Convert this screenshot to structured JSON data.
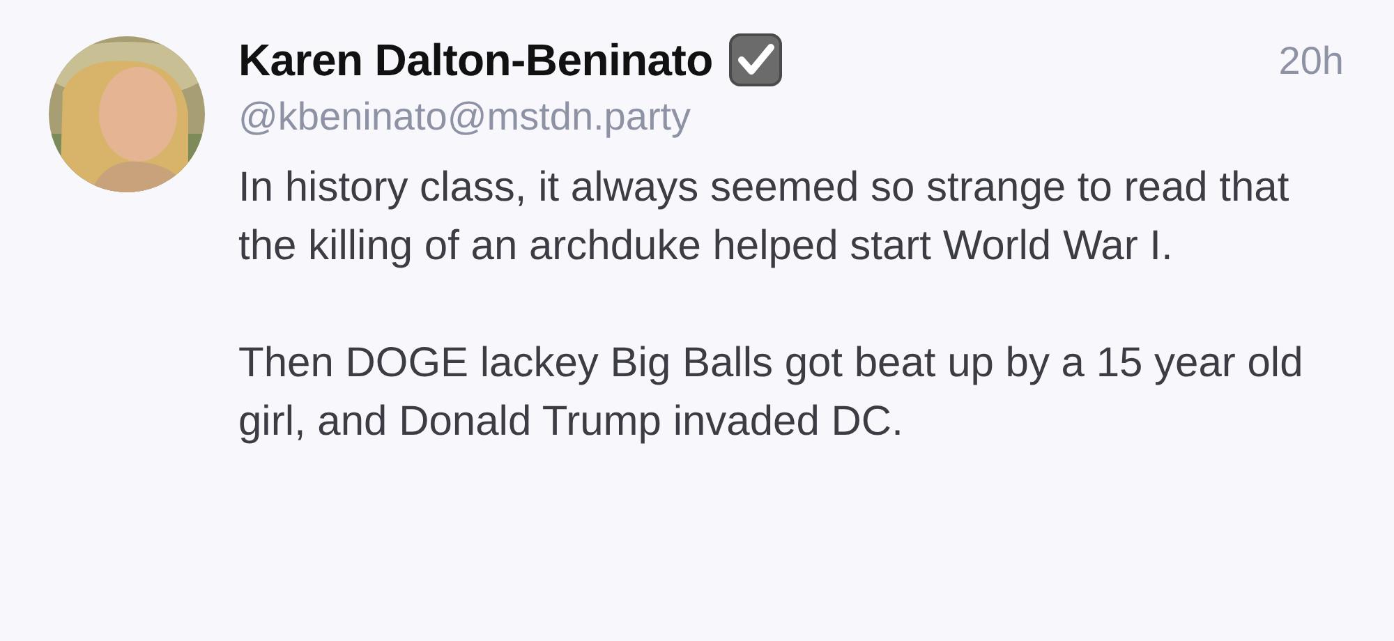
{
  "post": {
    "author": "Karen Dalton-Beninato",
    "verified": true,
    "handle": "@kbeninato@mstdn.party",
    "time": "20h",
    "paragraphs": [
      "In history class, it always seemed so strange to read that the killing of an archduke helped start World War I.",
      "Then DOGE lackey Big Balls got beat up by a 15 year old girl, and Donald Trump invaded DC."
    ]
  }
}
